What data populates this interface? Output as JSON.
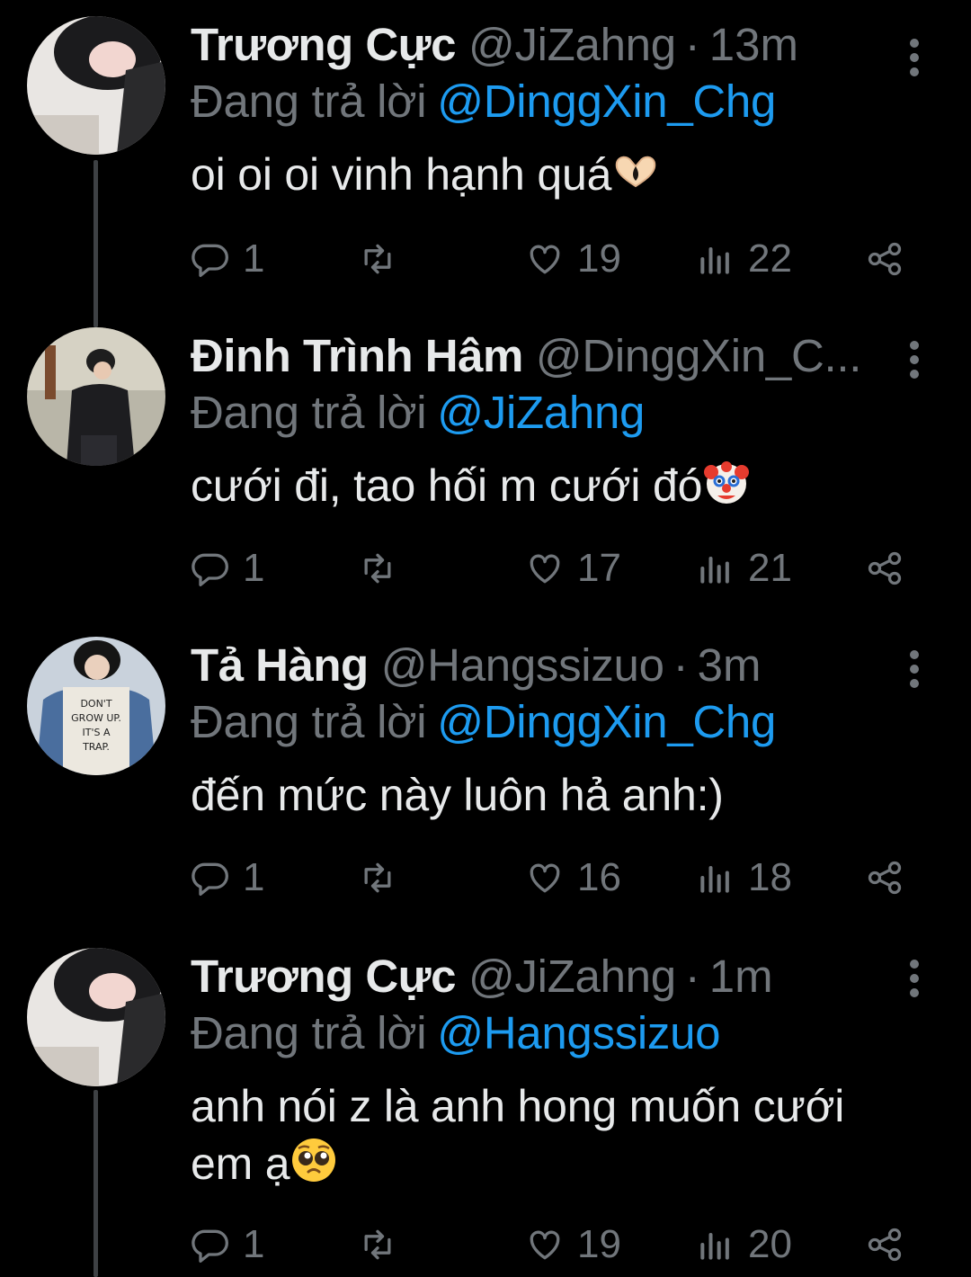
{
  "replying_prefix": "Đang trả lời",
  "tweets": [
    {
      "name": "Trương Cực",
      "handle": "@JiZahng",
      "time": "13m",
      "reply_to": "@DinggXin_Chg",
      "text": "oi oi oi vinh hạnh quá",
      "emoji": "heart-hands-emoji",
      "replies": "1",
      "likes": "19",
      "views": "22"
    },
    {
      "name": "Đinh Trình Hâm",
      "handle": "@DinggXin_C...",
      "time": "",
      "reply_to": "@JiZahng",
      "text": "cưới đi, tao hối m cưới đó",
      "emoji": "clown-face-emoji",
      "replies": "1",
      "likes": "17",
      "views": "21"
    },
    {
      "name": "Tả Hàng",
      "handle": "@Hangssizuo",
      "time": "3m",
      "reply_to": "@DinggXin_Chg",
      "text": "đến mức này luôn hả anh:)",
      "emoji": "",
      "replies": "1",
      "likes": "16",
      "views": "18"
    },
    {
      "name": "Trương Cực",
      "handle": "@JiZahng",
      "time": "1m",
      "reply_to": "@Hangssizuo",
      "text": "anh nói z là anh hong muốn cưới em ạ",
      "emoji": "pleading-face-emoji",
      "replies": "1",
      "likes": "19",
      "views": "20"
    }
  ],
  "avatar_texts": {
    "hang_shirt": [
      "DON'T",
      "GROW UP.",
      "IT'S A",
      "TRAP."
    ]
  },
  "colors": {
    "background": "#000000",
    "text": "#e7e9ea",
    "secondary": "#71767b",
    "link": "#1d9bf0",
    "thread_line": "#3e4144"
  },
  "icons": {
    "reply": "reply-icon",
    "retweet": "retweet-icon",
    "like": "heart-icon",
    "views": "views-icon",
    "share": "share-icon",
    "more": "more-vertical-icon"
  }
}
